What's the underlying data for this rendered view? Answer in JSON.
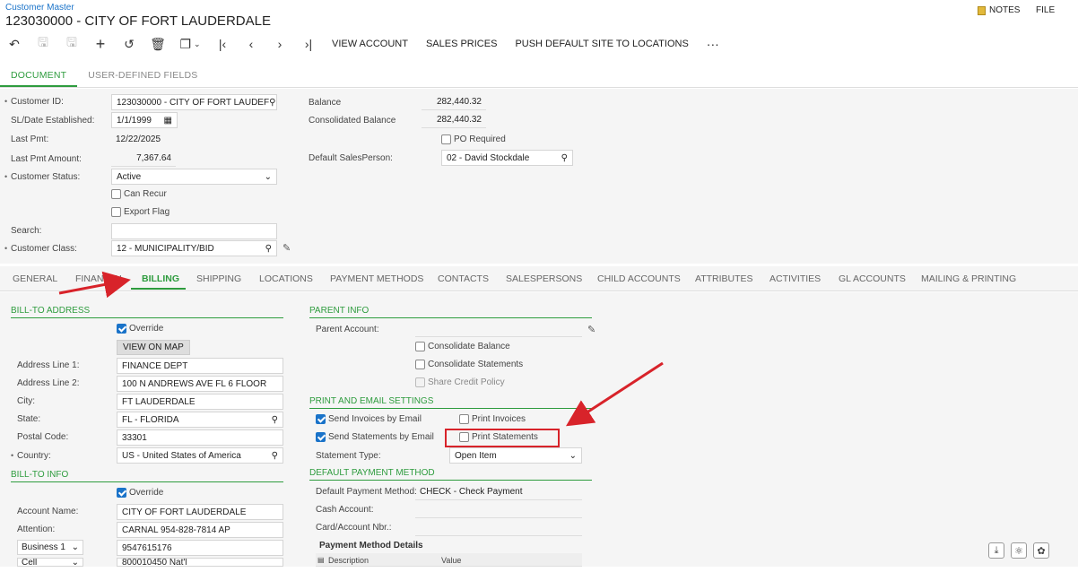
{
  "breadcrumb": "Customer Master",
  "title": "123030000 - CITY OF FORT LAUDERDALE",
  "top_right": {
    "notes": "NOTES",
    "file": "FILE"
  },
  "toolbar": {
    "view_account": "VIEW ACCOUNT",
    "sales_prices": "SALES PRICES",
    "push_default": "PUSH DEFAULT SITE TO LOCATIONS",
    "more": "···"
  },
  "doc_tabs": [
    "DOCUMENT",
    "USER-DEFINED FIELDS"
  ],
  "summary": {
    "customer_id_label": "Customer ID:",
    "customer_id": "123030000 - CITY OF FORT LAUDEF",
    "sl_date_label": "SL/Date Established:",
    "sl_date": "1/1/1999",
    "last_pmt_label": "Last Pmt:",
    "last_pmt": "12/22/2025",
    "last_pmt_amount_label": "Last Pmt Amount:",
    "last_pmt_amount": "7,367.64",
    "customer_status_label": "Customer Status:",
    "customer_status": "Active",
    "can_recur": "Can Recur",
    "export_flag": "Export Flag",
    "search_label": "Search:",
    "search_value": "",
    "customer_class_label": "Customer Class:",
    "customer_class": "12 - MUNICIPALITY/BID",
    "balance_label": "Balance",
    "balance": "282,440.32",
    "cons_balance_label": "Consolidated Balance",
    "cons_balance": "282,440.32",
    "po_required": "PO Required",
    "default_salesperson_label": "Default SalesPerson:",
    "default_salesperson": "02 - David Stockdale"
  },
  "sub_tabs": [
    "GENERAL",
    "FINANCIAL",
    "BILLING",
    "SHIPPING",
    "LOCATIONS",
    "PAYMENT METHODS",
    "CONTACTS",
    "SALESPERSONS",
    "CHILD ACCOUNTS",
    "ATTRIBUTES",
    "ACTIVITIES",
    "GL ACCOUNTS",
    "MAILING & PRINTING"
  ],
  "bill_to_address": {
    "header": "BILL-TO ADDRESS",
    "override": "Override",
    "view_on_map": "VIEW ON MAP",
    "line1_label": "Address Line 1:",
    "line1": "FINANCE DEPT",
    "line2_label": "Address Line 2:",
    "line2": "100 N ANDREWS AVE FL 6 FLOOR",
    "city_label": "City:",
    "city": "FT LAUDERDALE",
    "state_label": "State:",
    "state": "FL - FLORIDA",
    "postal_label": "Postal Code:",
    "postal": "33301",
    "country_label": "Country:",
    "country": "US - United States of America"
  },
  "bill_to_info": {
    "header": "BILL-TO INFO",
    "override": "Override",
    "account_name_label": "Account Name:",
    "account_name": "CITY OF FORT LAUDERDALE",
    "attention_label": "Attention:",
    "attention": "CARNAL 954-828-7814 AP",
    "phone1_type": "Business 1",
    "phone1": "9547615176",
    "phone2_type": "Cell",
    "phone2": "800010450 Nat'l"
  },
  "parent_info": {
    "header": "PARENT INFO",
    "parent_account_label": "Parent Account:",
    "consolidate_balance": "Consolidate Balance",
    "consolidate_statements": "Consolidate Statements",
    "share_credit_policy": "Share Credit Policy"
  },
  "print_email": {
    "header": "PRINT AND EMAIL SETTINGS",
    "send_invoices": "Send Invoices by Email",
    "print_invoices": "Print Invoices",
    "send_statements": "Send Statements by Email",
    "print_statements": "Print Statements",
    "statement_type_label": "Statement Type:",
    "statement_type": "Open Item"
  },
  "default_payment": {
    "header": "DEFAULT PAYMENT METHOD",
    "method_label": "Default Payment Method:",
    "method": "CHECK - Check Payment",
    "cash_account_label": "Cash Account:",
    "card_account_label": "Card/Account Nbr.:",
    "details_header": "Payment Method Details",
    "col_description": "Description",
    "col_value": "Value"
  },
  "colors": {
    "accent_green": "#2e9c3e",
    "link_blue": "#1a73c9",
    "annotation_red": "#d8232a"
  }
}
